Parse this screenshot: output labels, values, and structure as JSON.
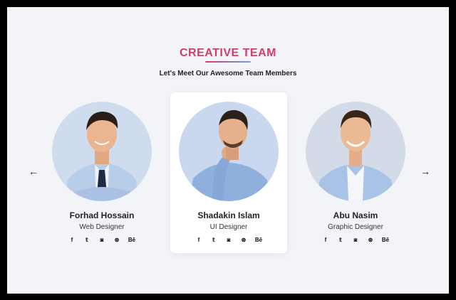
{
  "header": {
    "title": "CREATIVE TEAM",
    "subtitle": "Let's Meet Our Awesome Team Members"
  },
  "nav": {
    "prev_icon": "arrow-left-icon",
    "prev_glyph": "←",
    "next_icon": "arrow-right-icon",
    "next_glyph": "→"
  },
  "colors": {
    "accent": "#d23d6a",
    "background": "#f3f4f8",
    "card": "#ffffff"
  },
  "team": [
    {
      "name": "Forhad Hossain",
      "role": "Web Designer",
      "active": false,
      "avatar_bg": "#cfdcee",
      "socials": [
        "f",
        "𝕥",
        "◙",
        "⊛",
        "Bē"
      ]
    },
    {
      "name": "Shadakin Islam",
      "role": "UI Designer",
      "active": true,
      "avatar_bg": "#c9d8ee",
      "socials": [
        "f",
        "𝕥",
        "◙",
        "⊛",
        "Bē"
      ]
    },
    {
      "name": "Abu Nasim",
      "role": "Graphic Designer",
      "active": false,
      "avatar_bg": "#d3dbe8",
      "socials": [
        "f",
        "𝕥",
        "◙",
        "⊛",
        "Bē"
      ]
    }
  ],
  "social_icons": [
    "facebook-icon",
    "twitter-icon",
    "instagram-icon",
    "dribbble-icon",
    "behance-icon"
  ]
}
